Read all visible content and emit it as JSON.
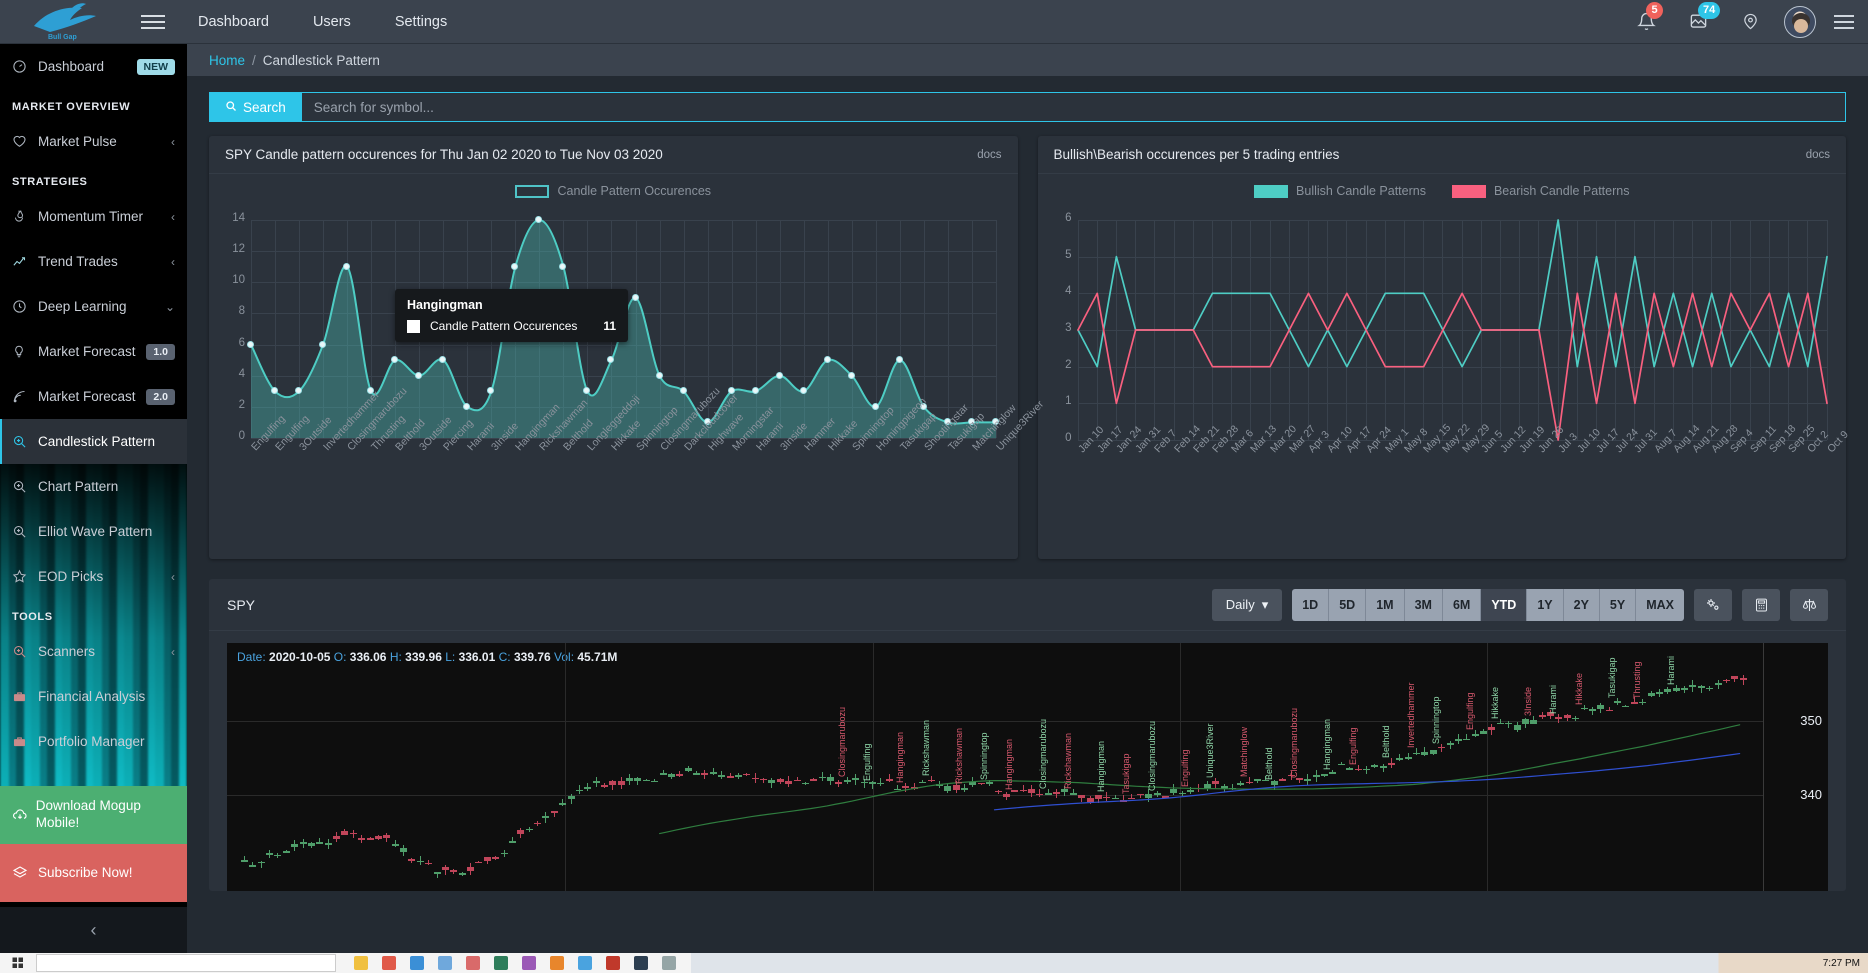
{
  "topbar": {
    "brand_name": "Bull Gap",
    "nav": [
      {
        "label": "Dashboard"
      },
      {
        "label": "Users"
      },
      {
        "label": "Settings"
      }
    ],
    "notifications_badge": "5",
    "charts_badge": "74"
  },
  "sidebar": {
    "dashboard": {
      "label": "Dashboard",
      "pill": "NEW"
    },
    "sections": [
      {
        "title": "MARKET OVERVIEW",
        "items": [
          {
            "label": "Market Pulse",
            "icon": "heart-icon",
            "caret": "‹",
            "pill": null,
            "active": false
          }
        ]
      },
      {
        "title": "STRATEGIES",
        "items": [
          {
            "label": "Momentum Timer",
            "icon": "flame-icon",
            "caret": "‹",
            "pill": null,
            "active": false
          },
          {
            "label": "Trend Trades",
            "icon": "trendline-icon",
            "caret": "‹",
            "pill": null,
            "active": false
          },
          {
            "label": "Deep Learning",
            "icon": "clock-icon",
            "caret": "⌄",
            "pill": null,
            "active": false
          },
          {
            "label": "Market Forecast",
            "icon": "bulb-icon",
            "caret": null,
            "pill": "1.0",
            "active": false
          },
          {
            "label": "Market Forecast",
            "icon": "signal-icon",
            "caret": null,
            "pill": "2.0",
            "active": false
          },
          {
            "label": "Candlestick Pattern",
            "icon": "zoom-in-icon",
            "caret": null,
            "pill": null,
            "active": true
          },
          {
            "label": "Chart Pattern",
            "icon": "zoom-in-icon",
            "caret": null,
            "pill": null,
            "active": false
          },
          {
            "label": "Elliot Wave Pattern",
            "icon": "zoom-in-icon",
            "caret": null,
            "pill": null,
            "active": false
          },
          {
            "label": "EOD Picks",
            "icon": "star-icon",
            "caret": "‹",
            "pill": null,
            "active": false
          }
        ]
      },
      {
        "title": "TOOLS",
        "items": [
          {
            "label": "Scanners",
            "icon": "zoom-in-icon",
            "caret": "‹",
            "pill": null,
            "active": false
          },
          {
            "label": "Financial Analysis",
            "icon": "briefcase-icon",
            "caret": null,
            "pill": null,
            "active": false
          },
          {
            "label": "Portfolio Manager",
            "icon": "briefcase-icon",
            "caret": null,
            "pill": null,
            "active": false
          }
        ]
      }
    ],
    "cta_download": "Download Mogup Mobile!",
    "cta_subscribe": "Subscribe Now!",
    "collapse_glyph": "‹"
  },
  "breadcrumb": {
    "home": "Home",
    "separator": "/",
    "current": "Candlestick Pattern"
  },
  "search": {
    "button_label": "Search",
    "placeholder": "Search for symbol...",
    "value": ""
  },
  "cards": {
    "left": {
      "title": "SPY Candle pattern occurences for Thu Jan 02 2020 to Tue Nov 03 2020",
      "docs": "docs"
    },
    "right": {
      "title": "Bullish\\Bearish occurences per 5 trading entries",
      "docs": "docs"
    }
  },
  "tooltip": {
    "title": "Hangingman",
    "series_label": "Candle Pattern Occurences",
    "value": "11"
  },
  "spy": {
    "title": "SPY",
    "interval": "Daily",
    "ranges": [
      "1D",
      "5D",
      "1M",
      "3M",
      "6M",
      "YTD",
      "1Y",
      "2Y",
      "5Y",
      "MAX"
    ],
    "active_range": "YTD",
    "icon_buttons": [
      "settings-gear-icon",
      "calculator-icon",
      "compare-scales-icon"
    ],
    "ohlc": {
      "date_key": "Date:",
      "date_val": "2020-10-05",
      "o_key": "O:",
      "o_val": "336.06",
      "h_key": "H:",
      "h_val": "339.96",
      "l_key": "L:",
      "l_val": "336.01",
      "c_key": "C:",
      "c_val": "339.76",
      "vol_key": "Vol:",
      "vol_val": "45.71M"
    },
    "price_labels": [
      "350",
      "340"
    ]
  },
  "taskbar": {
    "clock": "7:27 PM"
  },
  "colors": {
    "accent": "#2ec5e8",
    "bullish": "#4ecdc4",
    "bearish": "#f9607f",
    "area_fill": "#4a8a8d",
    "green_cta": "#4caf72",
    "red_cta": "#d9635f"
  },
  "chart_data": [
    {
      "type": "area",
      "title": "SPY Candle pattern occurences for Thu Jan 02 2020 to Tue Nov 03 2020",
      "xlabel": "",
      "ylabel": "",
      "ylim": [
        0,
        14
      ],
      "yticks": [
        0,
        2,
        4,
        6,
        8,
        10,
        12,
        14
      ],
      "grid": true,
      "legend": [
        "Candle Pattern Occurences"
      ],
      "legend_position": "top-center",
      "categories": [
        "Engulfing",
        "Engulfing",
        "3Outside",
        "Invertedhammer",
        "Closingmarubozu",
        "Thrusting",
        "Belthold",
        "3Outside",
        "Piercing",
        "Harami",
        "3Inside",
        "Hangingman",
        "Rickshawman",
        "Belthold",
        "Longleggeddoji",
        "Hikkake",
        "Spinningtop",
        "Closingmarubozu",
        "Darkcloudcover",
        "Highwave",
        "Morningstar",
        "Harami",
        "3Inside",
        "Hammer",
        "Hikkake",
        "Spinningtop",
        "Homingpigeon",
        "Tasukigap",
        "Shootingstar",
        "Tasukigap",
        "Matchinglow",
        "Unique3River"
      ],
      "values": [
        6,
        3,
        3,
        6,
        11,
        3,
        5,
        4,
        5,
        2,
        3,
        11,
        14,
        11,
        3,
        5,
        9,
        4,
        3,
        1,
        3,
        3,
        4,
        3,
        5,
        4,
        2,
        5,
        2,
        1,
        1,
        1
      ],
      "series": [
        {
          "name": "Candle Pattern Occurences",
          "color": "#4ecdc4"
        }
      ],
      "highlight_point": {
        "category": "Hangingman",
        "value": 11
      }
    },
    {
      "type": "line",
      "title": "Bullish\\Bearish occurences per 5 trading entries",
      "xlabel": "",
      "ylabel": "",
      "ylim": [
        0,
        6
      ],
      "yticks": [
        0,
        1,
        2,
        3,
        4,
        5,
        6
      ],
      "grid": true,
      "legend_position": "top-center",
      "categories": [
        "Jan 10",
        "Jan 17",
        "Jan 24",
        "Jan 31",
        "Feb 7",
        "Feb 14",
        "Feb 21",
        "Feb 28",
        "Mar 6",
        "Mar 13",
        "Mar 20",
        "Mar 27",
        "Apr 3",
        "Apr 10",
        "Apr 17",
        "Apr 24",
        "May 1",
        "May 8",
        "May 15",
        "May 22",
        "May 29",
        "Jun 5",
        "Jun 12",
        "Jun 19",
        "Jun 26",
        "Jul 3",
        "Jul 10",
        "Jul 17",
        "Jul 24",
        "Jul 31",
        "Aug 7",
        "Aug 14",
        "Aug 21",
        "Aug 28",
        "Sep 4",
        "Sep 11",
        "Sep 18",
        "Sep 25",
        "Oct 2",
        "Oct 9"
      ],
      "series": [
        {
          "name": "Bullish Candle Patterns",
          "color": "#4ecdc4",
          "values": [
            3,
            2,
            5,
            3,
            3,
            3,
            3,
            4,
            4,
            4,
            4,
            3,
            2,
            3,
            2,
            3,
            4,
            4,
            4,
            3,
            2,
            3,
            3,
            3,
            3,
            6,
            2,
            5,
            2,
            5,
            2,
            4,
            2,
            4,
            2,
            3,
            2,
            4,
            2,
            5
          ]
        },
        {
          "name": "Bearish Candle Patterns",
          "color": "#f9607f",
          "values": [
            3,
            4,
            1,
            3,
            3,
            3,
            3,
            2,
            2,
            2,
            2,
            3,
            4,
            3,
            4,
            3,
            2,
            2,
            2,
            3,
            4,
            3,
            3,
            3,
            3,
            0,
            4,
            1,
            4,
            1,
            4,
            2,
            4,
            2,
            4,
            3,
            4,
            2,
            4,
            1
          ]
        }
      ]
    },
    {
      "type": "candlestick",
      "title": "SPY",
      "price_ticks": [
        350,
        340
      ],
      "ohlc_readout": "Date: 2020-10-05 O: 336.06 H: 339.96 L: 336.01 C: 339.76 Vol: 45.71M",
      "pattern_annotations": [
        "Closingmarubozu",
        "Engulfing",
        "Hangingman",
        "Rickshawman",
        "Rickshawman",
        "Spinningtop",
        "Hangingman",
        "Closingmarubozu",
        "Rickshawman",
        "Hangingman",
        "Tasukigap",
        "Closingmarubozu",
        "Engulfing",
        "Unique3River",
        "Matchinglow",
        "Belthold",
        "Closingmarubozu",
        "Hangingman",
        "Engulfing",
        "Belthold",
        "Invertedhammer",
        "Spinningtop",
        "Engulfing",
        "Hikkake",
        "3Inside",
        "Harami",
        "Hikkake",
        "Tasukigap",
        "Thrusting",
        "Harami"
      ]
    }
  ]
}
